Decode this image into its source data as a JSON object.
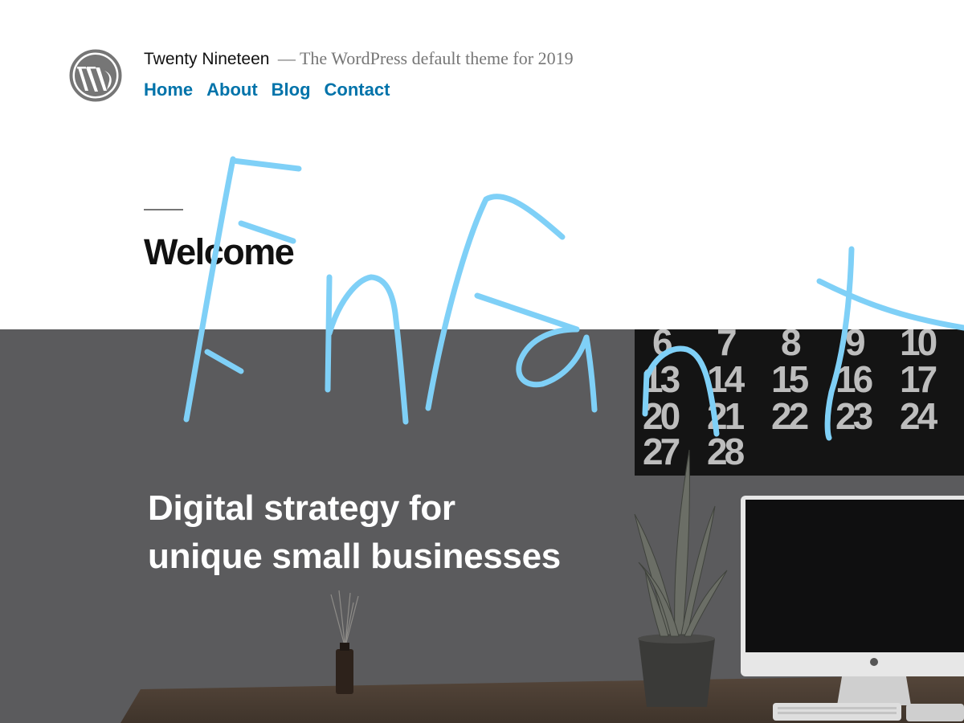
{
  "header": {
    "site_title": "Twenty Nineteen",
    "tagline": "— The WordPress default theme for 2019",
    "logo_icon": "wordpress-logo-icon"
  },
  "nav": {
    "items": [
      {
        "label": "Home"
      },
      {
        "label": "About"
      },
      {
        "label": "Blog"
      },
      {
        "label": "Contact"
      }
    ]
  },
  "content": {
    "title": "Welcome",
    "cover_text_line1": "Digital strategy for",
    "cover_text_line2": "unique small businesses",
    "calendar_numbers": [
      "6",
      "7",
      "8",
      "9",
      "10",
      "13",
      "14",
      "15",
      "16",
      "17",
      "20",
      "21",
      "22",
      "23",
      "24",
      "27",
      "28"
    ]
  },
  "overlay": {
    "handwriting_color": "#7fd0f7"
  },
  "colors": {
    "link": "#0073aa",
    "title": "#111111",
    "tagline": "#767676",
    "cover_overlay": "#5b5b5d"
  }
}
